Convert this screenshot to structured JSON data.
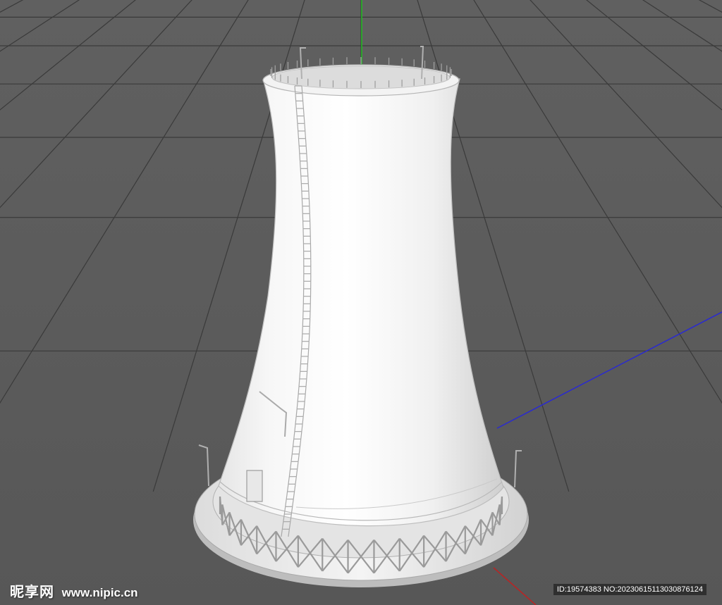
{
  "viewport": {
    "background": "#5b5b5b",
    "grid_color": "#3a3a3a",
    "axis_colors": {
      "y": "#22c022",
      "z": "#2a2ad0",
      "x": "#c02020"
    },
    "object": "cooling-tower",
    "object_color": "#f2f2f2"
  },
  "watermark": {
    "logo_text": "昵享网",
    "site_text": "www.nipic.cn",
    "id_text": "ID:19574383 NO:20230615113030876124"
  }
}
